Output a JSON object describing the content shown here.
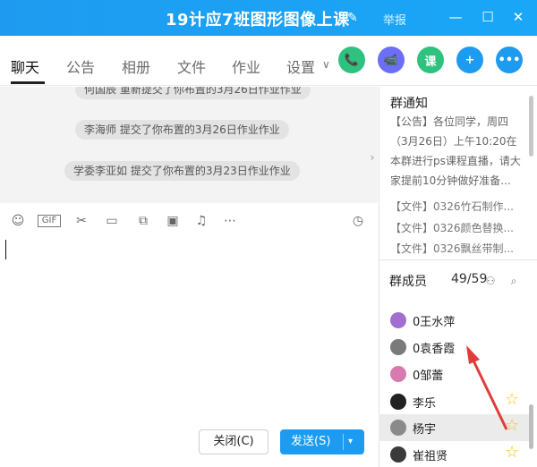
{
  "window": {
    "title": "19计应7班图形图像上课",
    "report": "举报",
    "controls": [
      "minimize-icon",
      "maximize-icon",
      "close-icon"
    ],
    "accent": "#1e9bf0"
  },
  "tabs": [
    {
      "label": "聊天",
      "active": true
    },
    {
      "label": "公告",
      "active": false
    },
    {
      "label": "相册",
      "active": false
    },
    {
      "label": "文件",
      "active": false
    },
    {
      "label": "作业",
      "active": false
    },
    {
      "label": "设置",
      "active": false
    }
  ],
  "app_buttons": [
    {
      "name": "phone-icon",
      "label": "📞",
      "color": "#2ec27e"
    },
    {
      "name": "video-icon",
      "label": "📹",
      "color": "#6c6ef7"
    },
    {
      "name": "course-icon",
      "label": "课",
      "color": "#2ec27e"
    },
    {
      "name": "share-screen-icon",
      "label": "+",
      "color": "#1d9bf0"
    },
    {
      "name": "more-icon",
      "label": "•••",
      "color": "#1d9bf0"
    }
  ],
  "chat_messages": [
    "何国辰 重新提交了你布置的3月26日作业作业",
    "李海师 提交了你布置的3月26日作业作业",
    "学委李亚如 提交了你布置的3月23日作业作业"
  ],
  "toolbar_icons": [
    "emoji-icon",
    "gif-icon",
    "scissors-icon",
    "folder-icon",
    "image-edit-icon",
    "picture-icon",
    "bell-icon",
    "more-dots-icon",
    "history-icon"
  ],
  "buttons": {
    "close": "关闭(C)",
    "send": "发送(S)",
    "send_arrow": "▾"
  },
  "sidebar": {
    "notice_title": "群通知",
    "notice_body": "【公告】各位同学，周四（3月26日）上午10:20在本群进行ps课程直播，请大家提前10分钟做好准备...",
    "files": [
      "【文件】0326竹石制作...",
      "【文件】0326颜色替换...",
      "【文件】0326飘丝带制..."
    ],
    "members_title": "群成员",
    "members_count": "49/59",
    "members": [
      {
        "name": "0王水萍",
        "avatar": "#a06fd0",
        "star": false,
        "highlight": false
      },
      {
        "name": "0袁香霞",
        "avatar": "#7a7a7a",
        "star": false,
        "highlight": false
      },
      {
        "name": "0邹蕾",
        "avatar": "#d77ab0",
        "star": false,
        "highlight": false
      },
      {
        "name": "李乐",
        "avatar": "#222",
        "star": true,
        "highlight": false
      },
      {
        "name": "杨宇",
        "avatar": "#8a8a8a",
        "star": true,
        "highlight": true
      },
      {
        "name": "崔祖贤",
        "avatar": "#3a3a3a",
        "star": true,
        "highlight": false
      }
    ]
  }
}
